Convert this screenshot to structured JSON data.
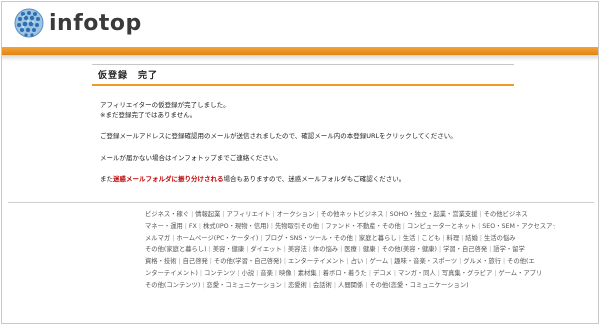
{
  "brand": {
    "logo_text": "infotop"
  },
  "page": {
    "title": "仮登録　完了",
    "messages": {
      "line1": "アフィリエイターの仮登録が完了しました。",
      "line2": "※まだ登録完了ではありません。",
      "line3": "ご登録メールアドレスに登録確認用のメールが送信されましたので、確認メール内の本登録URLをクリックしてください。",
      "line4": "メールが届かない場合はインフォトップまでご連絡ください。",
      "line5_prefix": "また",
      "line5_warning": "迷惑メールフォルダに振り分けされる",
      "line5_suffix": "場合もありますので、迷惑メールフォルダもご確認ください。"
    }
  },
  "categories": [
    [
      "ビジネス・稼ぐ",
      "情報起業",
      "アフィリエイト",
      "オークション",
      "その他ネットビジネス",
      "SOHO・独立・起業・営業支援",
      "その他ビジネス"
    ],
    [
      "マネー・運用",
      "FX",
      "株式(IPO・現物・信用)",
      "先物取引その他",
      "ファンド・不動産・その他",
      "コンピューターとネット",
      "SEO・SEM・アクセスアップ"
    ],
    [
      "メルマガ",
      "ホームページ(PC・ケータイ)",
      "ブログ・SNS・ツール・その他",
      "家庭と暮らし",
      "生活",
      "こども",
      "料理",
      "結婚",
      "生活の悩み"
    ],
    [
      "その他(家庭と暮らし)",
      "美容・健康",
      "ダイエット",
      "美容法",
      "体の悩み",
      "医療",
      "健康",
      "その他(美容・健康)",
      "学習・自己啓発",
      "語学・留学"
    ],
    [
      "資格・技術",
      "自己啓発",
      "その他(学習・自己啓発)",
      "エンターテイメント",
      "占い",
      "ゲーム",
      "趣味・音楽・スポーツ",
      "グルメ・旅行",
      "その他(エ"
    ],
    [
      "ンターテイメント)",
      "コンテンツ",
      "小説",
      "音楽",
      "映像",
      "素材集",
      "着ボロ・着うた",
      "デコメ",
      "マンガ・同人",
      "写真集・グラビア",
      "ゲーム・アプリ"
    ],
    [
      "その他(コンテンツ)",
      "恋愛・コミュニケーション",
      "恋愛術",
      "会話術",
      "人間関係",
      "その他(恋愛・コミュニケーション)"
    ]
  ]
}
